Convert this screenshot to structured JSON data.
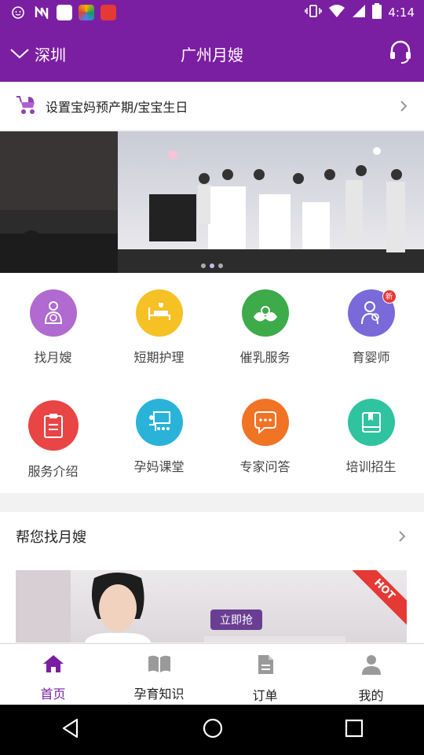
{
  "status_bar": {
    "time": "4:14",
    "colors": {
      "bg": "#7b1fa2"
    }
  },
  "header": {
    "city": "深圳",
    "title": "广州月嫂"
  },
  "due_date": {
    "label": "设置宝妈预产期/宝宝生日"
  },
  "grid": {
    "items": [
      {
        "label": "找月嫂",
        "color": "#b06ad0",
        "icon": "mother-baby-icon"
      },
      {
        "label": "短期护理",
        "color": "#f5c125",
        "icon": "nursing-bed-icon"
      },
      {
        "label": "催乳服务",
        "color": "#3dab4a",
        "icon": "lactation-icon"
      },
      {
        "label": "育婴师",
        "color": "#7a69d9",
        "icon": "nanny-icon",
        "badge": "新"
      },
      {
        "label": "服务介绍",
        "color": "#e94545",
        "icon": "clipboard-icon"
      },
      {
        "label": "孕妈课堂",
        "color": "#29b3d8",
        "icon": "classroom-icon"
      },
      {
        "label": "专家问答",
        "color": "#f17324",
        "icon": "chat-icon"
      },
      {
        "label": "培训招生",
        "color": "#2fc3a0",
        "icon": "book-icon"
      }
    ]
  },
  "find": {
    "title": "帮您找月嫂",
    "grab_label": "立即抢",
    "hot_label": "HOT"
  },
  "tabs": [
    {
      "label": "首页",
      "icon": "home-icon",
      "active": true
    },
    {
      "label": "孕育知识",
      "icon": "open-book-icon",
      "active": false
    },
    {
      "label": "订单",
      "icon": "document-icon",
      "active": false
    },
    {
      "label": "我的",
      "icon": "person-icon",
      "active": false
    }
  ]
}
